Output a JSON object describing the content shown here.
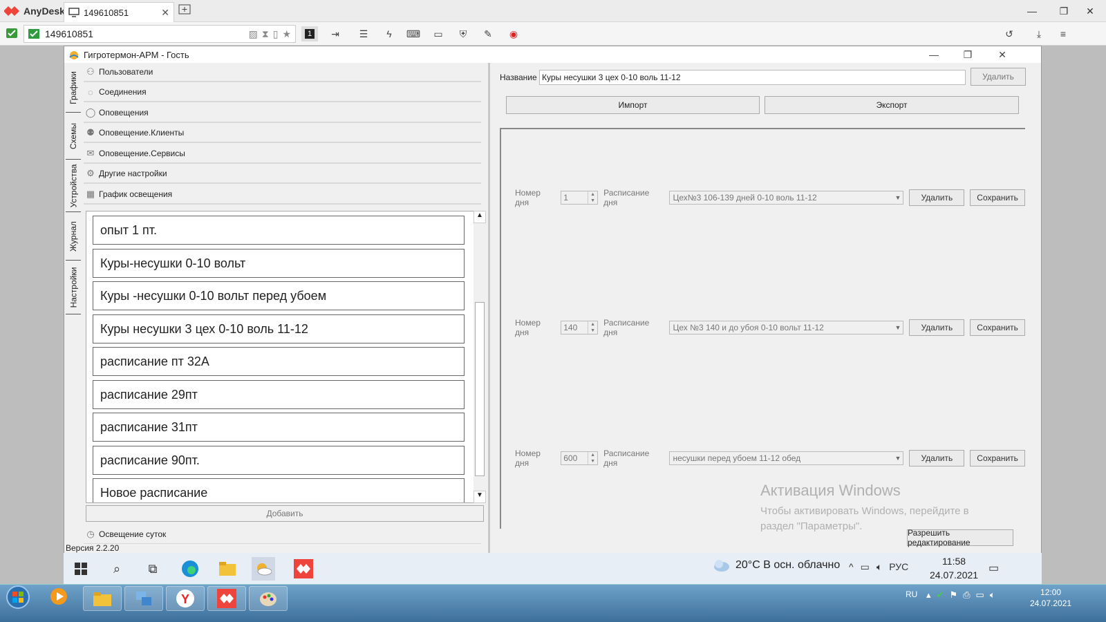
{
  "anydesk": {
    "brand": "AnyDesk",
    "tab_label": "149610851",
    "address_value": "149610851",
    "monitor_badge": "1"
  },
  "app": {
    "title": "Гигротермон-АРМ - Гость",
    "version": "Версия 2.2.20",
    "vertical_tabs": [
      "Графики",
      "Схемы",
      "Устройства",
      "Журнал",
      "Настройки"
    ],
    "accordion": [
      {
        "label": "Пользователи",
        "icon": "users-icon"
      },
      {
        "label": "Соединения",
        "icon": "connections-icon"
      },
      {
        "label": "Оповещения",
        "icon": "chat-bubble-icon"
      },
      {
        "label": "Оповещение.Клиенты",
        "icon": "client-icon"
      },
      {
        "label": "Оповещение.Сервисы",
        "icon": "mail-icon"
      },
      {
        "label": "Другие настройки",
        "icon": "gear-icon"
      },
      {
        "label": "График освещения",
        "icon": "calendar-icon"
      }
    ],
    "schedule_list": [
      "опыт 1 пт.",
      "Куры-несушки 0-10 вольт",
      "Куры -несушки 0-10 вольт перед убоем",
      "Куры несушки 3 цех   0-10 воль 11-12",
      "расписание пт 32А",
      "расписание 29пт",
      "расписание 31пт",
      "расписание 90пт.",
      "Новое расписание"
    ],
    "add_button": "Добавить",
    "day_light_section": "Освещение суток",
    "right": {
      "name_label": "Название",
      "name_value": "Куры несушки 3 цех   0-10 воль 11-12",
      "delete_button": "Удалить",
      "import_button": "Импорт",
      "export_button": "Экспорт",
      "rows": [
        {
          "day_label": "Номер дня",
          "day_value": "1",
          "schedule_label": "Расписание дня",
          "schedule_value": "Цех№3 106-139 дней 0-10 воль 11-12",
          "delete": "Удалить",
          "save": "Сохранить"
        },
        {
          "day_label": "Номер дня",
          "day_value": "140",
          "schedule_label": "Расписание дня",
          "schedule_value": "Цех №3 140 и до убоя 0-10 вольт 11-12",
          "delete": "Удалить",
          "save": "Сохранить"
        },
        {
          "day_label": "Номер дня",
          "day_value": "600",
          "schedule_label": "Расписание дня",
          "schedule_value": "несушки перед убоем  11-12 обед",
          "delete": "Удалить",
          "save": "Сохранить"
        }
      ],
      "allow_edit_button": "Разрешить редактирование"
    },
    "watermark": {
      "title": "Активация Windows",
      "subtitle": "Чтобы активировать Windows, перейдите в раздел \"Параметры\"."
    }
  },
  "remote_taskbar": {
    "weather": "20°C  В осн. облачно",
    "lang": "РУС",
    "time": "11:58",
    "date": "24.07.2021"
  },
  "local_taskbar": {
    "lang": "RU",
    "time": "12:00",
    "date": "24.07.2021"
  },
  "colors": {
    "anydesk_red": "#ef443b",
    "taskbar_blue": "#3d6f9b"
  }
}
